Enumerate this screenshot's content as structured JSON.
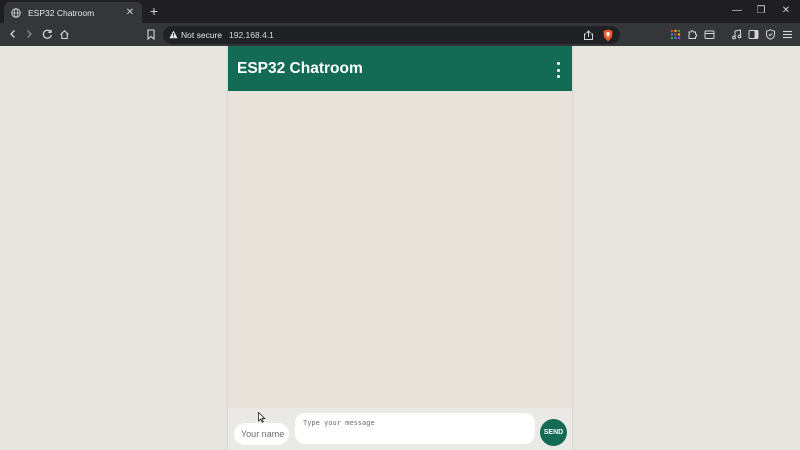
{
  "browser": {
    "tab": {
      "title": "ESP32 Chatroom",
      "favicon": "globe-icon",
      "close": "✕"
    },
    "new_tab": "+",
    "window_controls": {
      "minimize": "—",
      "restore": "❐",
      "close": "✕"
    },
    "security_label": "Not secure",
    "url": "192.168.4.1",
    "icons": [
      "back-icon",
      "forward-icon",
      "reload-icon",
      "home-icon",
      "bookmark-icon",
      "share-icon",
      "brave-shield-icon",
      "apps-grid-icon",
      "puzzle-extension-icon",
      "wallet-icon",
      "media-icon",
      "sidebar-icon",
      "vpn-shield-icon",
      "menu-icon"
    ]
  },
  "chat": {
    "title": "ESP32 Chatroom",
    "name_placeholder": "Your name",
    "message_placeholder": "Type your message",
    "send_label": "SEND",
    "accent_color": "#136b55",
    "background_color": "#e9e3db"
  }
}
